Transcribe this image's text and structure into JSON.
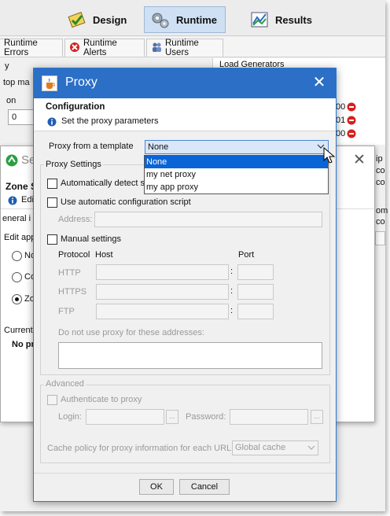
{
  "toolbar": {
    "modes": [
      {
        "label": "Design"
      },
      {
        "label": "Runtime"
      },
      {
        "label": "Results"
      }
    ]
  },
  "subtabs": [
    {
      "label": "Runtime Errors"
    },
    {
      "label": "Runtime Alerts"
    },
    {
      "label": "Runtime Users"
    }
  ],
  "background": {
    "y_fragment": "y",
    "top_ma": "top ma",
    "on_fragment": "on",
    "field_value": "0",
    "load_generators": "Load Generators",
    "counters": [
      "00",
      "01",
      "00",
      "00"
    ],
    "right_labels": [
      "ip",
      "co",
      "co",
      "om",
      "co"
    ]
  },
  "zone_window": {
    "title_fragment": "Se",
    "zone_label": "Zone S",
    "edit_fragment": "Edi",
    "general_fragment": "eneral i",
    "edit_app": "Edit app",
    "radios": [
      "No",
      "Co",
      "Zo"
    ],
    "current": "Current",
    "no_pr": "No pr"
  },
  "dialog": {
    "title": "Proxy",
    "header_title": "Configuration",
    "header_subtitle": "Set the proxy parameters",
    "template_label": "Proxy from a template",
    "template_value": "None",
    "template_options": [
      "None",
      "my net proxy",
      "my app proxy"
    ],
    "proxy_settings_title": "Proxy Settings",
    "auto_detect": "Automatically detect se",
    "use_script": "Use automatic configuration script",
    "address_label": "Address:",
    "manual_settings": "Manual settings",
    "col_protocol": "Protocol",
    "col_host": "Host",
    "col_port": "Port",
    "protocols": [
      "HTTP",
      "HTTPS",
      "FTP"
    ],
    "colon": ":",
    "no_proxy_label": "Do not use proxy for these addresses:",
    "advanced_title": "Advanced",
    "authenticate": "Authenticate to proxy",
    "login_label": "Login:",
    "password_label": "Password:",
    "ellipsis": "...",
    "cache_label": "Cache policy for proxy information for each URL",
    "cache_value": "Global cache",
    "ok": "OK",
    "cancel": "Cancel"
  },
  "colors": {
    "titlebar": "#2b6fc6",
    "selection": "#0a64d6",
    "active_mode": "#cfe0f5",
    "error_red": "#d42020"
  }
}
